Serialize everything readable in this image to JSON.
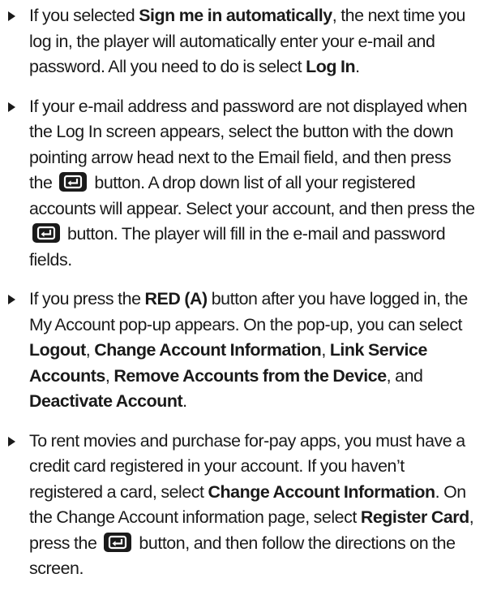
{
  "bullets": [
    {
      "segments": [
        {
          "text": "If you selected ",
          "style": "normal"
        },
        {
          "text": "Sign me in automatically",
          "style": "bold"
        },
        {
          "text": ", the next time you log in, the player will automatically enter your e-mail and password. All you need to do is select ",
          "style": "normal"
        },
        {
          "text": "Log In",
          "style": "bold"
        },
        {
          "text": ".",
          "style": "normal"
        }
      ]
    },
    {
      "segments": [
        {
          "text": "If your e-mail address and password are not displayed when the Log In screen appears, select the button with the down pointing arrow head next to the Email field, and then press the ",
          "style": "normal"
        },
        {
          "icon": "enter-button-icon"
        },
        {
          "text": " button. A drop down list of all your registered accounts will appear. Select your account, and then press the ",
          "style": "normal"
        },
        {
          "icon": "enter-button-icon"
        },
        {
          "text": " button. The player will fill in the e-mail and password fields.",
          "style": "normal"
        }
      ]
    },
    {
      "segments": [
        {
          "text": "If you press the ",
          "style": "normal"
        },
        {
          "text": "RED (A)",
          "style": "bold"
        },
        {
          "text": " button after you have logged in, the My Account pop-up appears. On the pop-up, you can select ",
          "style": "normal"
        },
        {
          "text": "Logout",
          "style": "bold"
        },
        {
          "text": ", ",
          "style": "normal"
        },
        {
          "text": "Change Account Information",
          "style": "bold"
        },
        {
          "text": ", ",
          "style": "normal"
        },
        {
          "text": "Link Service Accounts",
          "style": "bold"
        },
        {
          "text": ", ",
          "style": "normal"
        },
        {
          "text": "Remove Accounts from the Device",
          "style": "bold"
        },
        {
          "text": ", and ",
          "style": "normal"
        },
        {
          "text": "Deactivate Account",
          "style": "bold"
        },
        {
          "text": ".",
          "style": "normal"
        }
      ]
    },
    {
      "segments": [
        {
          "text": "To rent movies and purchase for-pay apps, you must have a credit card registered in your account. If you haven’t registered a card, select ",
          "style": "normal"
        },
        {
          "text": "Change Account Information",
          "style": "bold"
        },
        {
          "text": ". On the Change Account information page, select ",
          "style": "normal"
        },
        {
          "text": "Register Card",
          "style": "bold"
        },
        {
          "text": ", press the ",
          "style": "normal"
        },
        {
          "icon": "enter-button-icon"
        },
        {
          "text": " button, and then follow the directions on the screen.",
          "style": "normal"
        }
      ]
    }
  ],
  "colors": {
    "text": "#1a1a1a",
    "icon_background": "#1a1a1a",
    "icon_glyph": "#ffffff"
  }
}
